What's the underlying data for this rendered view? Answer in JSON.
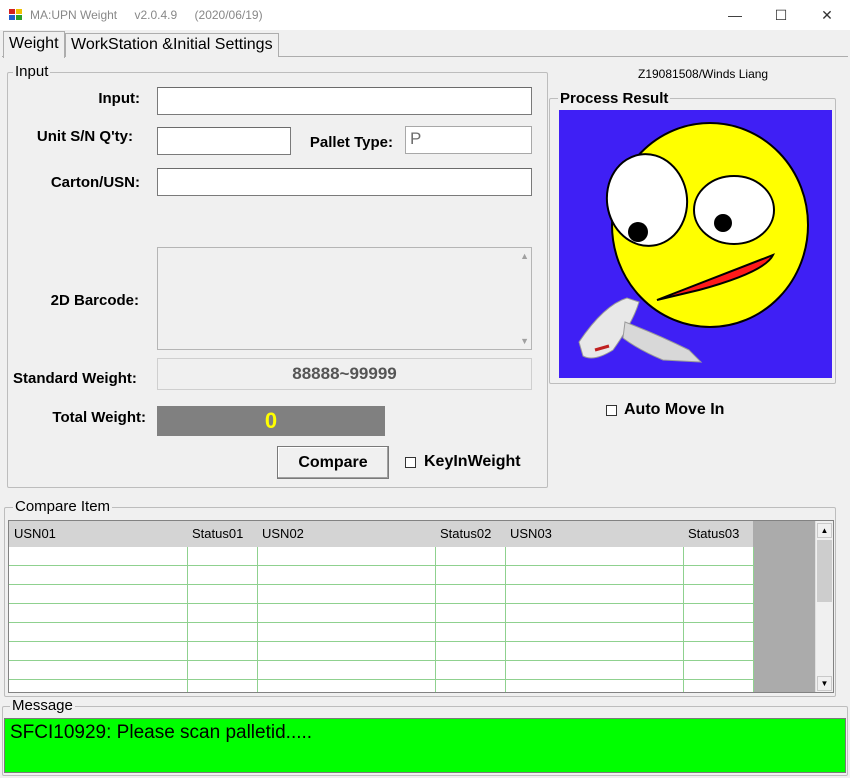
{
  "window": {
    "app_name": "MA:UPN Weight",
    "version": "v2.0.4.9",
    "date": "(2020/06/19)",
    "minimize_glyph": "—",
    "maximize_glyph": "☐",
    "close_glyph": "✕"
  },
  "tabs": [
    {
      "label": "Weight",
      "active": true
    },
    {
      "label": "WorkStation &Initial Settings",
      "active": false
    }
  ],
  "user_info": "Z19081508/Winds Liang",
  "input_group": {
    "title": "Input",
    "input_label": "Input:",
    "input_value": "",
    "unit_sn_label": "Unit S/N Q'ty:",
    "unit_sn_value": "",
    "pallet_type_label": "Pallet Type:",
    "pallet_type_value": "P",
    "carton_label": "Carton/USN:",
    "carton_value": "",
    "barcode_label": "2D Barcode:",
    "barcode_value": "",
    "standard_weight_label": "Standard Weight:",
    "standard_weight_value": "88888~99999",
    "total_weight_label": "Total Weight:",
    "total_weight_value": "0",
    "compare_button": "Compare",
    "keyin_weight_label": "KeyInWeight",
    "keyin_weight_checked": false
  },
  "process_result": {
    "title": "Process Result",
    "image_icon": "confused-face-with-scanner",
    "background_color": "#3f1ff5"
  },
  "auto_move_in": {
    "label": "Auto Move In",
    "checked": false
  },
  "compare_item": {
    "title": "Compare Item",
    "columns": [
      "USN01",
      "Status01",
      "USN02",
      "Status02",
      "USN03",
      "Status03"
    ],
    "rows": [
      [
        "",
        "",
        "",
        "",
        "",
        ""
      ],
      [
        "",
        "",
        "",
        "",
        "",
        ""
      ],
      [
        "",
        "",
        "",
        "",
        "",
        ""
      ],
      [
        "",
        "",
        "",
        "",
        "",
        ""
      ],
      [
        "",
        "",
        "",
        "",
        "",
        ""
      ],
      [
        "",
        "",
        "",
        "",
        "",
        ""
      ],
      [
        "",
        "",
        "",
        "",
        "",
        ""
      ],
      [
        "",
        "",
        "",
        "",
        "",
        ""
      ]
    ]
  },
  "message": {
    "title": "Message",
    "text": "SFCI10929: Please scan palletid.....",
    "background_color": "#00ff00"
  }
}
